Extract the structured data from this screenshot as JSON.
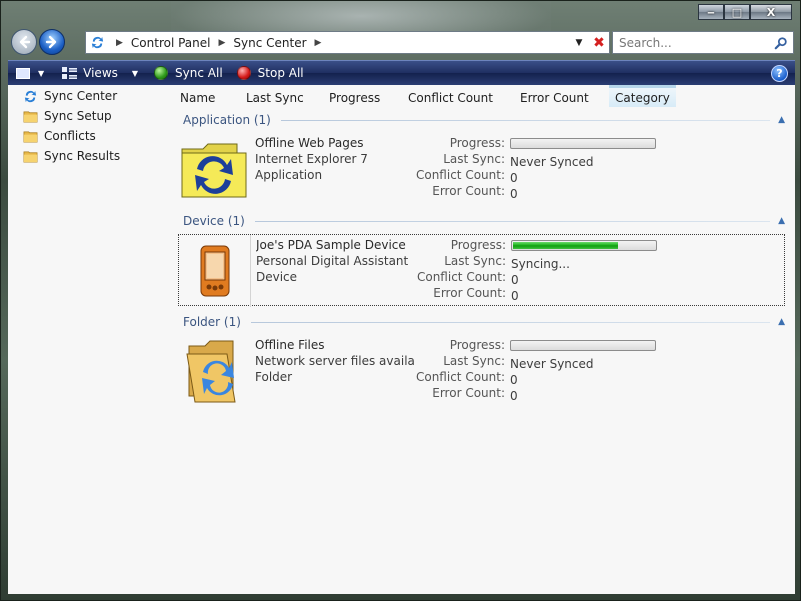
{
  "address": {
    "crumbs": [
      "Control Panel",
      "Sync Center"
    ]
  },
  "search": {
    "placeholder": "Search..."
  },
  "toolbar": {
    "views_label": "Views",
    "sync_all_label": "Sync All",
    "stop_all_label": "Stop All",
    "help_label": "?"
  },
  "window_controls": {
    "minimize": "‒",
    "maximize": "□",
    "close": "X"
  },
  "sidebar": {
    "items": [
      {
        "label": "Sync Center",
        "icon": "sync-icon"
      },
      {
        "label": "Sync Setup",
        "icon": "folder-icon"
      },
      {
        "label": "Conflicts",
        "icon": "folder-icon"
      },
      {
        "label": "Sync Results",
        "icon": "folder-icon"
      }
    ]
  },
  "columns": [
    "Name",
    "Last Sync",
    "Progress",
    "Conflict Count",
    "Error Count",
    "Category"
  ],
  "field_labels": {
    "progress": "Progress:",
    "last_sync": "Last Sync:",
    "conflict_count": "Conflict Count:",
    "error_count": "Error Count:"
  },
  "groups": [
    {
      "header": "Application (1)",
      "item": {
        "icon": "sync-folder-icon",
        "name": "Offline Web Pages",
        "detail": "Internet Explorer 7",
        "category": "Application",
        "progress": 0,
        "last_sync": "Never Synced",
        "conflict_count": "0",
        "error_count": "0"
      }
    },
    {
      "header": "Device (1)",
      "item": {
        "icon": "pda-icon",
        "name": "Joe's PDA Sample Device",
        "detail": "Personal Digital Assistant",
        "category": "Device",
        "progress": 0.74,
        "last_sync": "Syncing...",
        "conflict_count": "0",
        "error_count": "0"
      }
    },
    {
      "header": "Folder (1)",
      "item": {
        "icon": "offline-files-icon",
        "name": "Offline Files",
        "detail": "Network server files availa...",
        "category": "Folder",
        "progress": 0,
        "last_sync": "Never Synced",
        "conflict_count": "0",
        "error_count": "0"
      }
    }
  ],
  "colors": {
    "toolbar": "#1f2f61",
    "group_header_text": "#3b5580",
    "progress_fill": "#17b017"
  }
}
